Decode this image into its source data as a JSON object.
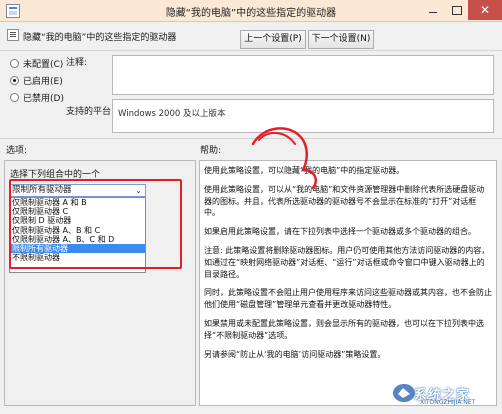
{
  "window": {
    "title": "隐藏“我的电脑”中的这些指定的驱动器",
    "close_glyph": "✕"
  },
  "header": {
    "title": "隐藏“我的电脑”中的这些指定的驱动器",
    "prev_button": "上一个设置(P)",
    "next_button": "下一个设置(N)"
  },
  "state": {
    "options": [
      {
        "label": "未配置(C)",
        "selected": false
      },
      {
        "label": "已启用(E)",
        "selected": true
      },
      {
        "label": "已禁用(D)",
        "selected": false
      }
    ]
  },
  "fields": {
    "comment_label": "注释:",
    "comment_value": "",
    "platform_label": "支持的平台:",
    "platform_value": "Windows 2000 及以上版本"
  },
  "sections": {
    "options_label": "选项:",
    "help_label": "帮助:"
  },
  "options_panel": {
    "caption": "选择下列组合中的一个",
    "select_value": "限制所有驱动器",
    "dropdown_items": [
      {
        "label": "仅限制驱动器 A 和 B",
        "selected": false
      },
      {
        "label": "仅限制驱动器 C",
        "selected": false
      },
      {
        "label": "仅限制 D 驱动器",
        "selected": false
      },
      {
        "label": "仅限制驱动器 A、B 和 C",
        "selected": false
      },
      {
        "label": "仅限制驱动器 A、B、C 和 D",
        "selected": false
      },
      {
        "label": "限制所有驱动器",
        "selected": true
      },
      {
        "label": "不限制驱动器",
        "selected": false
      }
    ]
  },
  "help": {
    "paragraphs": [
      "使用此策略设置，可以隐藏“我的电脑”中的指定驱动器。",
      "使用此策略设置，可以从“我的电脑”和文件资源管理器中删除代表所选硬盘驱动器的图标。并且，代表所选驱动器的驱动器号不会显示在标准的“打开”对话框中。",
      "如果启用此策略设置，请在下拉列表中选择一个驱动器或多个驱动器的组合。",
      "注意: 此策略设置将删除驱动器图标。用户仍可使用其他方法访问驱动器的内容，如通过在“映射网络驱动器”对话框、“运行”对话框或命令窗口中键入驱动器上的目录路径。",
      "同时，此策略设置不会阻止用户使用程序来访问这些驱动器或其内容，也不会防止他们使用“磁盘管理”管理单元查看并更改驱动器特性。",
      "如果禁用或未配置此策略设置，则会显示所有的驱动器，也可以在下拉列表中选择“不限制驱动器”选项。",
      "另请参阅“防止从‘我的电脑’访问驱动器”策略设置。"
    ]
  },
  "watermark": {
    "text": "系统之家",
    "sub": "XITONGZHIJIA.NET"
  },
  "colors": {
    "titlebar": "#fbe9d6",
    "close_button": "#c7504b",
    "highlight_selection": "#3c8cf0",
    "annotation_red": "#e3202a"
  }
}
